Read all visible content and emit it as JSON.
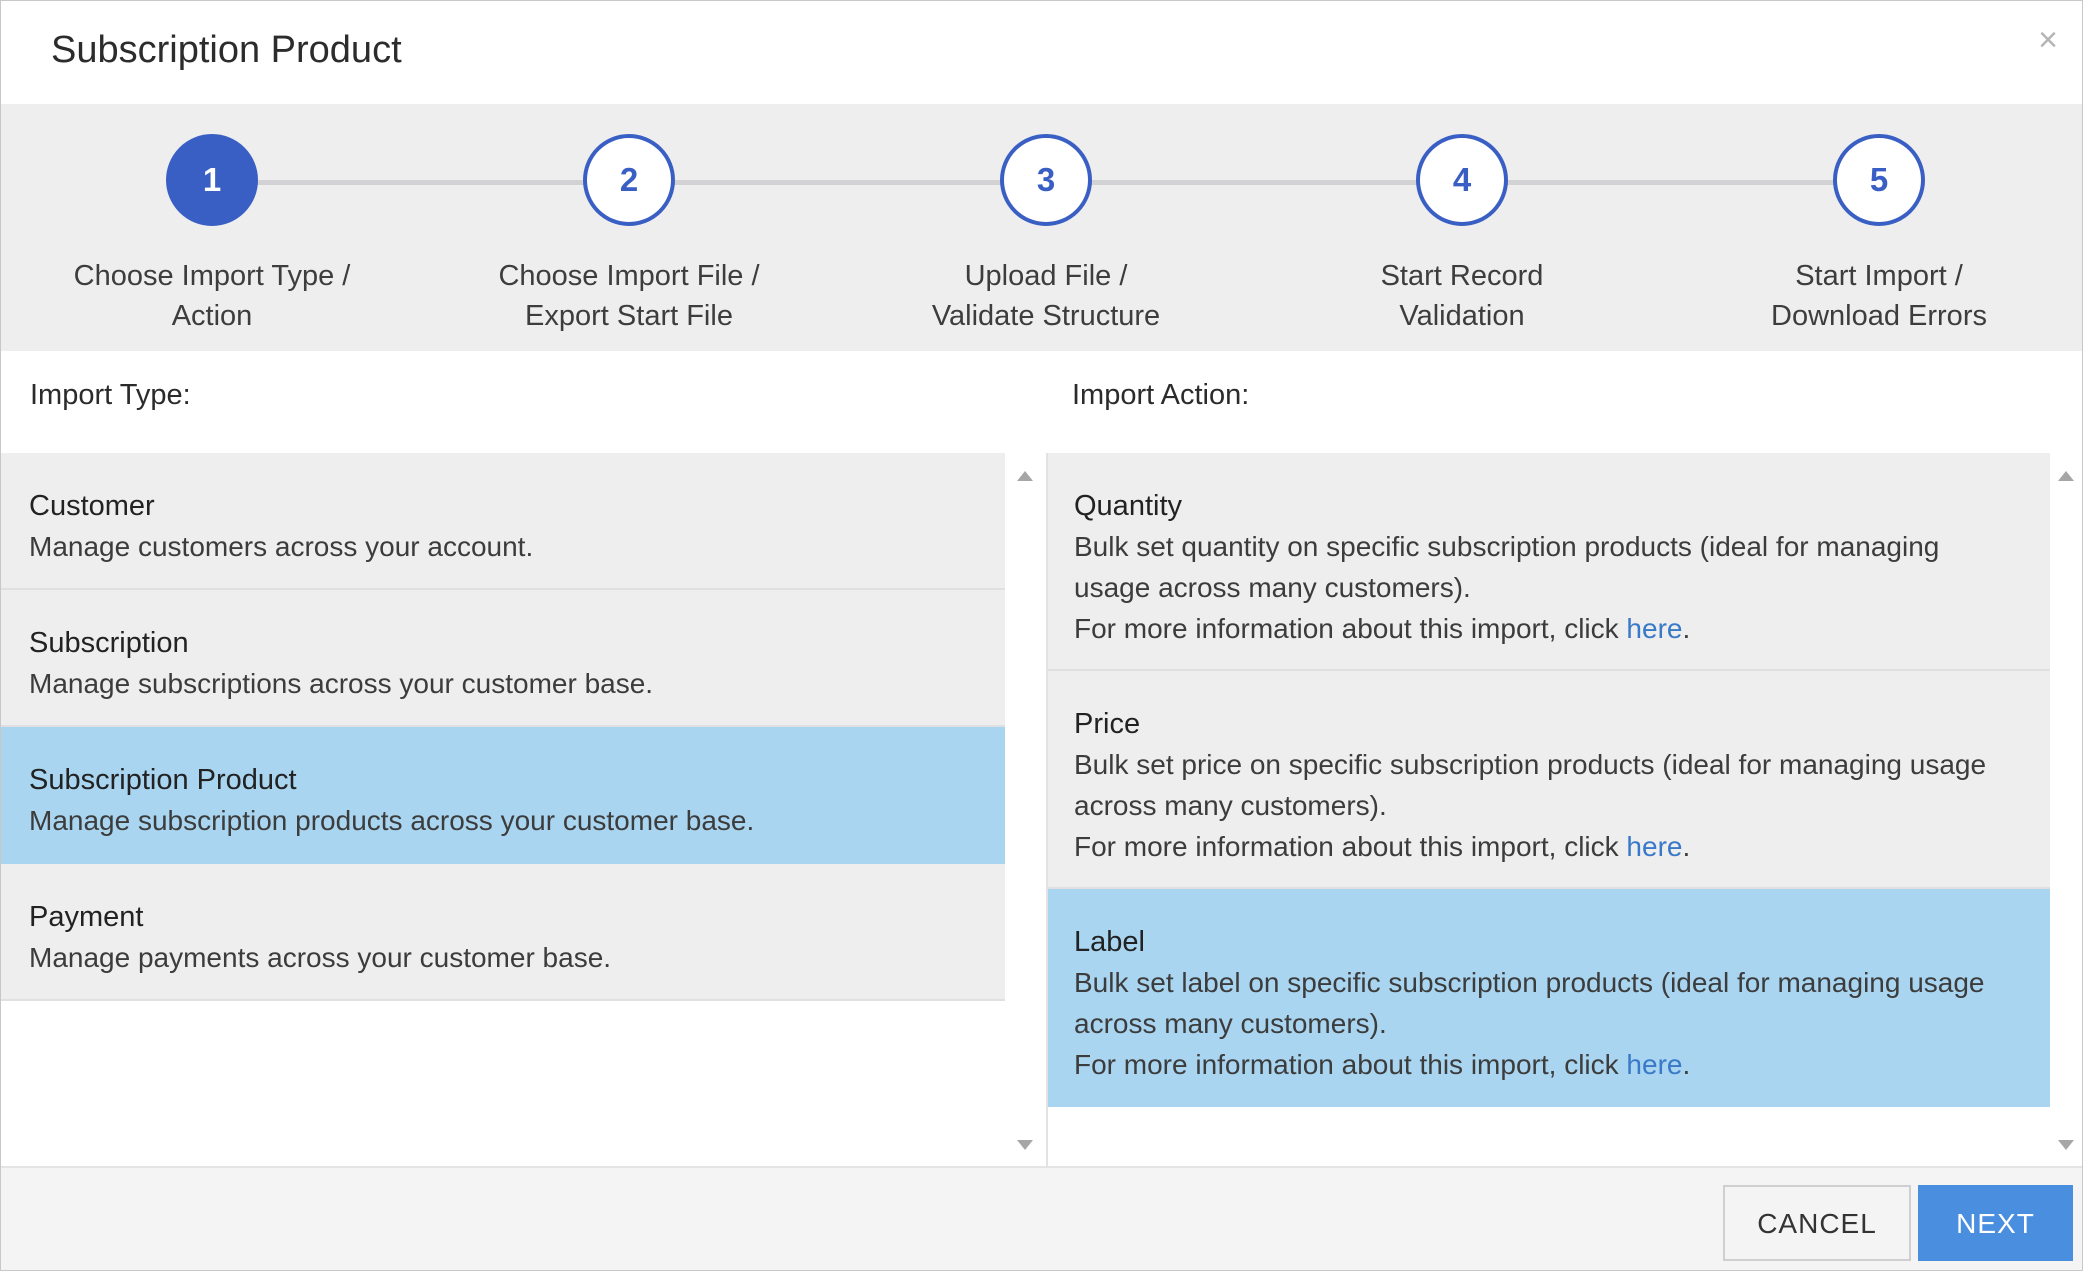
{
  "dialog": {
    "title": "Subscription Product",
    "close_glyph": "×"
  },
  "steps": [
    {
      "number": "1",
      "line1": "Choose Import Type /",
      "line2": "Action",
      "active": true
    },
    {
      "number": "2",
      "line1": "Choose Import File /",
      "line2": "Export Start File",
      "active": false
    },
    {
      "number": "3",
      "line1": "Upload File /",
      "line2": "Validate Structure",
      "active": false
    },
    {
      "number": "4",
      "line1": "Start Record",
      "line2": "Validation",
      "active": false
    },
    {
      "number": "5",
      "line1": "Start Import /",
      "line2": "Download Errors",
      "active": false
    }
  ],
  "import_type": {
    "label": "Import Type:",
    "items": [
      {
        "title": "Customer",
        "description": "Manage customers across your account."
      },
      {
        "title": "Subscription",
        "description": "Manage subscriptions across your customer base."
      },
      {
        "title": "Subscription Product",
        "description": "Manage subscription products across your customer base."
      },
      {
        "title": "Payment",
        "description": "Manage payments across your customer base."
      }
    ],
    "selected_index": 2
  },
  "import_action": {
    "label": "Import Action:",
    "items": [
      {
        "title": "Quantity",
        "description_line1": "Bulk set quantity on specific subscription products (ideal for managing",
        "description_line2": "usage across many customers).",
        "info_prefix": "For more information about this import, click ",
        "link_text": "here",
        "info_suffix": "."
      },
      {
        "title": "Price",
        "description_line1": "Bulk set price on specific subscription products (ideal for managing usage",
        "description_line2": "across many customers).",
        "info_prefix": "For more information about this import, click ",
        "link_text": "here",
        "info_suffix": "."
      },
      {
        "title": "Label",
        "description_line1": "Bulk set label on specific subscription products (ideal for managing usage",
        "description_line2": "across many customers).",
        "info_prefix": "For more information about this import, click ",
        "link_text": "here",
        "info_suffix": "."
      }
    ],
    "selected_index": 2
  },
  "footer": {
    "cancel_label": "CANCEL",
    "next_label": "NEXT"
  },
  "colors": {
    "accent": "#3a5fc4",
    "selected_row": "#a9d5f0",
    "primary_button": "#4a8ee0",
    "link": "#3a78c8"
  }
}
